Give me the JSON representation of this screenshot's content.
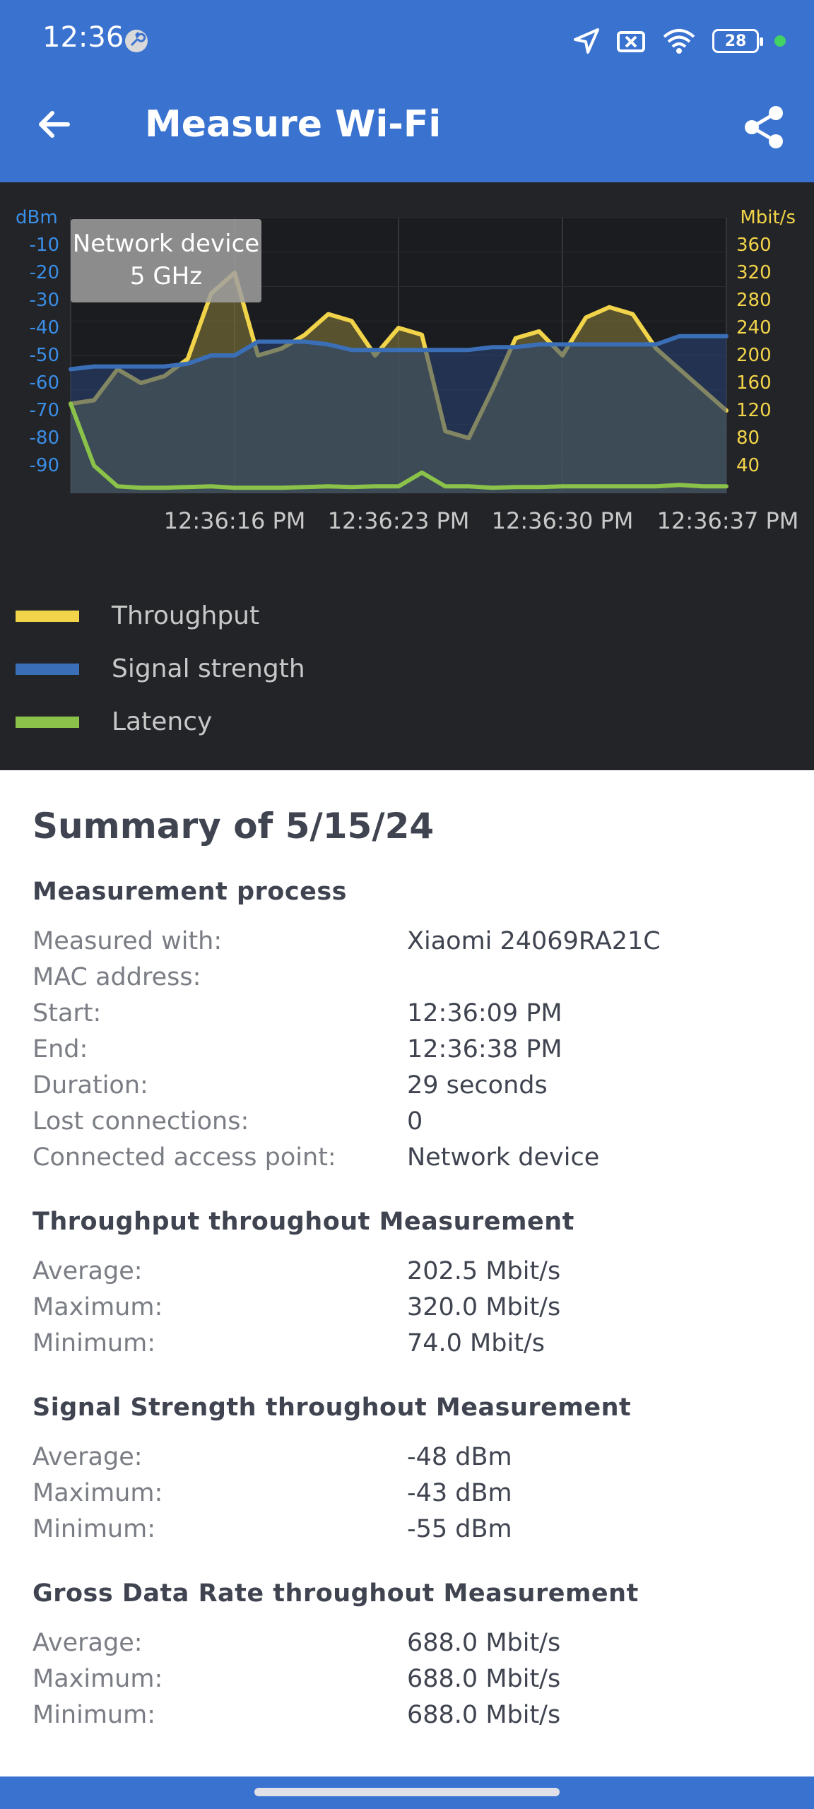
{
  "status": {
    "time": "12:36",
    "battery": "28"
  },
  "appbar": {
    "title": "Measure Wi-Fi"
  },
  "chart_data": {
    "type": "line",
    "y_left_label": "dBm",
    "y_right_label": "Mbit/s",
    "y_left_ticks": [
      "-10",
      "-20",
      "-30",
      "-40",
      "-50",
      "-60",
      "-70",
      "-80",
      "-90"
    ],
    "y_right_ticks": [
      "360",
      "320",
      "280",
      "240",
      "200",
      "160",
      "120",
      "80",
      "40"
    ],
    "x_ticks": [
      "12:36:16 PM",
      "12:36:23 PM",
      "12:36:30 PM",
      "12:36:37 PM"
    ],
    "tooltip": {
      "line1": "Network device",
      "line2": "5 GHz"
    },
    "series": [
      {
        "name": "Throughput",
        "color": "#f2d44a",
        "axis": "Mbit/s",
        "values": [
          130,
          135,
          180,
          160,
          170,
          195,
          290,
          320,
          200,
          210,
          230,
          260,
          250,
          200,
          240,
          230,
          90,
          80,
          150,
          225,
          235,
          200,
          255,
          270,
          260,
          210,
          180,
          150,
          120
        ]
      },
      {
        "name": "Signal strength",
        "color": "#3a6fb8",
        "axis": "dBm",
        "values": [
          -55,
          -54,
          -54,
          -54,
          -54,
          -53,
          -50,
          -50,
          -45,
          -45,
          -45,
          -46,
          -48,
          -48,
          -48,
          -48,
          -48,
          -48,
          -47,
          -47,
          -46,
          -46,
          -46,
          -46,
          -46,
          -46,
          -43,
          -43,
          -43
        ]
      },
      {
        "name": "Latency",
        "color": "#8bc34a",
        "axis": "Mbit/s",
        "values": [
          130,
          40,
          10,
          8,
          8,
          9,
          10,
          8,
          8,
          8,
          9,
          10,
          9,
          10,
          10,
          30,
          10,
          10,
          8,
          9,
          9,
          10,
          10,
          10,
          10,
          10,
          12,
          10,
          10
        ]
      }
    ]
  },
  "summary": {
    "title": "Summary of 5/15/24",
    "sections": [
      {
        "title": "Measurement process",
        "rows": [
          {
            "k": "Measured with:",
            "v": "Xiaomi 24069RA21C"
          },
          {
            "k": "MAC address:",
            "v": ""
          },
          {
            "k": "Start:",
            "v": "12:36:09 PM"
          },
          {
            "k": "End:",
            "v": "12:36:38 PM"
          },
          {
            "k": "Duration:",
            "v": "29 seconds"
          },
          {
            "k": "Lost connections:",
            "v": "0"
          },
          {
            "k": "Connected access point:",
            "v": "Network device"
          }
        ]
      },
      {
        "title": "Throughput throughout Measurement",
        "rows": [
          {
            "k": "Average:",
            "v": "202.5 Mbit/s"
          },
          {
            "k": "Maximum:",
            "v": "320.0 Mbit/s"
          },
          {
            "k": "Minimum:",
            "v": "74.0 Mbit/s"
          }
        ]
      },
      {
        "title": "Signal Strength throughout Measurement",
        "rows": [
          {
            "k": "Average:",
            "v": "-48 dBm"
          },
          {
            "k": "Maximum:",
            "v": "-43 dBm"
          },
          {
            "k": "Minimum:",
            "v": "-55 dBm"
          }
        ]
      },
      {
        "title": "Gross Data Rate throughout Measurement",
        "rows": [
          {
            "k": "Average:",
            "v": "688.0 Mbit/s"
          },
          {
            "k": "Maximum:",
            "v": "688.0 Mbit/s"
          },
          {
            "k": "Minimum:",
            "v": "688.0 Mbit/s"
          }
        ]
      }
    ]
  }
}
